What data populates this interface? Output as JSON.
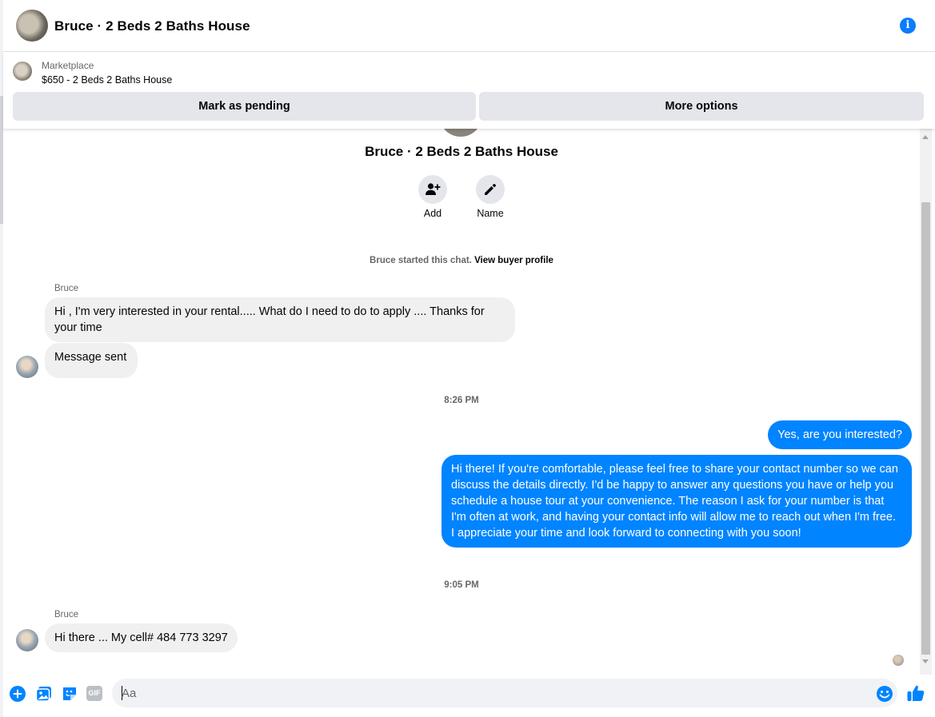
{
  "header": {
    "title": "Bruce · 2 Beds 2 Baths House",
    "info_icon": "info-icon"
  },
  "marketplace": {
    "label": "Marketplace",
    "listing": "$650 - 2 Beds 2 Baths House",
    "mark_pending_label": "Mark as pending",
    "more_options_label": "More options"
  },
  "profile": {
    "name": "Bruce · 2 Beds 2 Baths House",
    "add_label": "Add",
    "name_label": "Name"
  },
  "chat": {
    "started_text": "Bruce started this chat.",
    "view_profile_link": "View buyer profile",
    "messages": [
      {
        "sender": "Bruce",
        "text": "Hi , I'm very interested in your rental..... What do I need to do to apply .... Thanks for your time"
      },
      {
        "text": "Message sent"
      },
      {
        "time": "8:26 PM"
      },
      {
        "text": "Yes, are you interested?"
      },
      {
        "text": "Hi there! If you're comfortable, please feel free to share your contact number so we can discuss the details directly. I'd be happy to answer any questions you have or help you schedule a house tour at your convenience. The reason I ask for your number is that I'm often at work, and having your contact info will allow me to reach out when I'm free. I appreciate your time and look forward to connecting with you soon!"
      },
      {
        "time": "9:05 PM"
      },
      {
        "sender": "Bruce",
        "text": "Hi there ... My cell# 484 773 3297"
      }
    ]
  },
  "composer": {
    "placeholder": "Aa",
    "icons": [
      "plus-icon",
      "photo-icon",
      "sticker-icon",
      "gif-icon",
      "emoji-icon",
      "thumbs-up-icon"
    ],
    "gif_label": "GIF"
  },
  "colors": {
    "accent": "#0084ff",
    "incoming_bubble": "#f0f0f0",
    "button_bg": "#e4e6eb"
  }
}
